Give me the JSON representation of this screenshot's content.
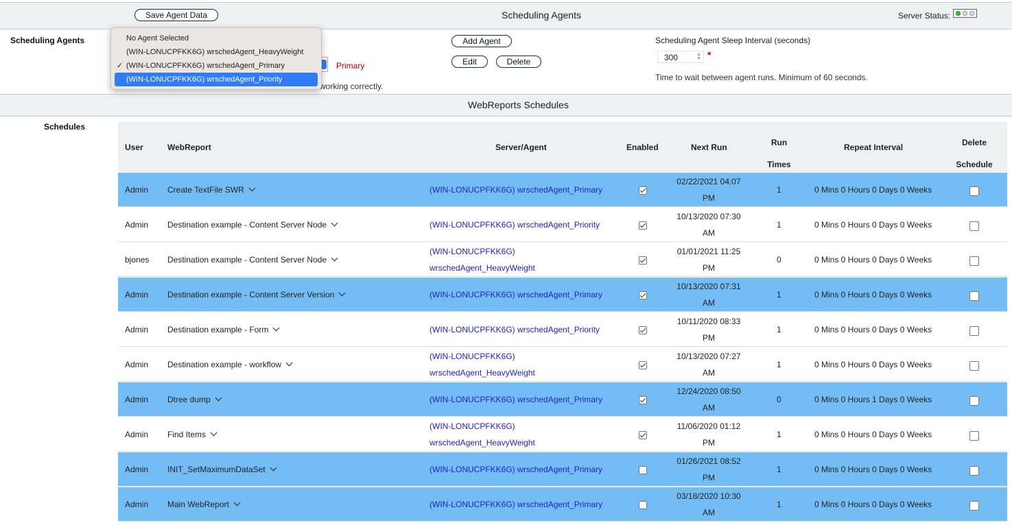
{
  "header": {
    "save_label": "Save Agent Data",
    "title": "Scheduling Agents",
    "server_status_label": "Server Status:"
  },
  "agents_section": {
    "label": "Scheduling Agents",
    "primary_label": "Primary",
    "note_fragment": "working correctly.",
    "add_label": "Add Agent",
    "edit_label": "Edit",
    "delete_label": "Delete",
    "sleep_label": "Scheduling Agent Sleep Interval (seconds)",
    "sleep_value": "300",
    "required_mark": "*",
    "sleep_help": "Time to wait between agent runs. Minimum of 60 seconds."
  },
  "dropdown": {
    "options": [
      "No Agent Selected",
      "(WIN-LONUCPFKK6G) wrschedAgent_HeavyWeight",
      "(WIN-LONUCPFKK6G) wrschedAgent_Primary",
      "(WIN-LONUCPFKK6G) wrschedAgent_Priority"
    ],
    "checked_index": 2,
    "highlighted_index": 3,
    "checkmark": "✓"
  },
  "schedules_band": {
    "title": "WebReports Schedules"
  },
  "schedules": {
    "label": "Schedules",
    "columns": {
      "user": "User",
      "webreport": "WebReport",
      "server_agent": "Server/Agent",
      "enabled": "Enabled",
      "next_run": "Next Run",
      "run_times_1": "Run",
      "run_times_2": "Times",
      "repeat": "Repeat Interval",
      "delete_1": "Delete",
      "delete_2": "Schedule"
    },
    "rows": [
      {
        "user": "Admin",
        "webreport": "Create TextFile SWR",
        "agent1": "(WIN-LONUCPFKK6G) wrschedAgent_Primary",
        "agent2": "",
        "enabled": true,
        "next1": "02/22/2021 04:07",
        "next2": "PM",
        "runs": "1",
        "repeat": "0 Mins 0 Hours 0 Days 0 Weeks",
        "hl": true
      },
      {
        "user": "Admin",
        "webreport": "Destination example - Content Server Node",
        "agent1": "(WIN-LONUCPFKK6G) wrschedAgent_Priority",
        "agent2": "",
        "enabled": true,
        "next1": "10/13/2020 07:30",
        "next2": "AM",
        "runs": "1",
        "repeat": "0 Mins 0 Hours 0 Days 0 Weeks",
        "hl": false
      },
      {
        "user": "bjones",
        "webreport": "Destination example - Content Server Node",
        "agent1": "(WIN-LONUCPFKK6G)",
        "agent2": "wrschedAgent_HeavyWeight",
        "enabled": true,
        "next1": "01/01/2021 11:25",
        "next2": "PM",
        "runs": "0",
        "repeat": "0 Mins 0 Hours 0 Days 0 Weeks",
        "hl": false
      },
      {
        "user": "Admin",
        "webreport": "Destination example - Content Server Version",
        "agent1": "(WIN-LONUCPFKK6G) wrschedAgent_Primary",
        "agent2": "",
        "enabled": true,
        "next1": "10/13/2020 07:31",
        "next2": "AM",
        "runs": "1",
        "repeat": "0 Mins 0 Hours 0 Days 0 Weeks",
        "hl": true
      },
      {
        "user": "Admin",
        "webreport": "Destination example - Form",
        "agent1": "(WIN-LONUCPFKK6G) wrschedAgent_Priority",
        "agent2": "",
        "enabled": true,
        "next1": "10/11/2020 08:33",
        "next2": "PM",
        "runs": "1",
        "repeat": "0 Mins 0 Hours 0 Days 0 Weeks",
        "hl": false
      },
      {
        "user": "Admin",
        "webreport": "Destination example - workflow",
        "agent1": "(WIN-LONUCPFKK6G)",
        "agent2": "wrschedAgent_HeavyWeight",
        "enabled": true,
        "next1": "10/13/2020 07:27",
        "next2": "AM",
        "runs": "1",
        "repeat": "0 Mins 0 Hours 0 Days 0 Weeks",
        "hl": false
      },
      {
        "user": "Admin",
        "webreport": "Dtree dump",
        "agent1": "(WIN-LONUCPFKK6G) wrschedAgent_Primary",
        "agent2": "",
        "enabled": true,
        "next1": "12/24/2020 08:50",
        "next2": "AM",
        "runs": "0",
        "repeat": "0 Mins 0 Hours 1 Days 0 Weeks",
        "hl": true
      },
      {
        "user": "Admin",
        "webreport": "Find Items",
        "agent1": "(WIN-LONUCPFKK6G)",
        "agent2": "wrschedAgent_HeavyWeight",
        "enabled": true,
        "next1": "11/06/2020 01:12",
        "next2": "PM",
        "runs": "1",
        "repeat": "0 Mins 0 Hours 0 Days 0 Weeks",
        "hl": false
      },
      {
        "user": "Admin",
        "webreport": "INIT_SetMaximumDataSet",
        "agent1": "(WIN-LONUCPFKK6G) wrschedAgent_Primary",
        "agent2": "",
        "enabled": false,
        "next1": "01/26/2021 08:52",
        "next2": "PM",
        "runs": "1",
        "repeat": "0 Mins 0 Hours 0 Days 0 Weeks",
        "hl": true
      },
      {
        "user": "Admin",
        "webreport": "Main WebReport",
        "agent1": "(WIN-LONUCPFKK6G) wrschedAgent_Primary",
        "agent2": "",
        "enabled": false,
        "next1": "03/18/2020 10:30",
        "next2": "AM",
        "runs": "1",
        "repeat": "0 Mins 0 Hours 0 Days 0 Weeks",
        "hl": true
      }
    ]
  },
  "colors": {
    "highlight_row": "#74bdf4",
    "agent_link": "#1f23c8",
    "primary_label": "#c00000",
    "selected_menu": "#2f7cf6",
    "status_green": "#3dbb3d"
  }
}
